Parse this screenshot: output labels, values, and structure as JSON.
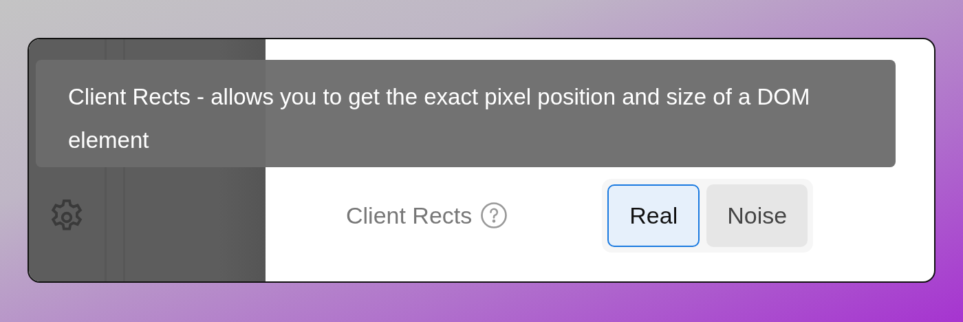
{
  "tooltip": {
    "text": "Client Rects - allows you to get the exact pixel position and size of a DOM element"
  },
  "setting": {
    "label": "Client Rects",
    "options": [
      {
        "label": "Real",
        "selected": true
      },
      {
        "label": "Noise",
        "selected": false
      }
    ]
  }
}
